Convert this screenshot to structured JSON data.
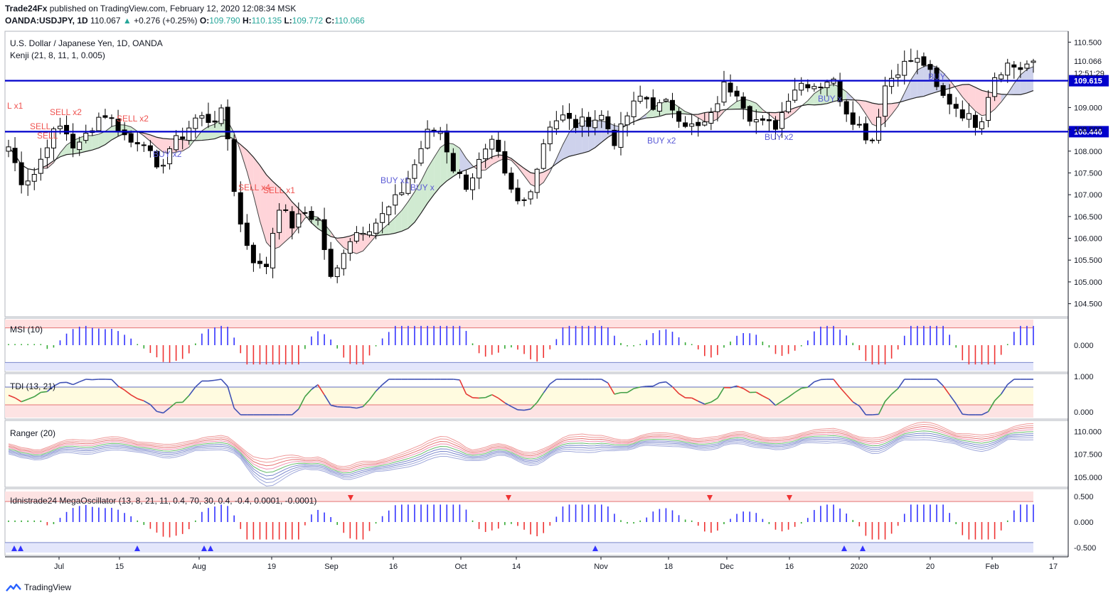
{
  "header": {
    "publisher": "Trade24Fx",
    "published_text": "published on TradingView.com, February 12, 2020 12:08:34 MSK",
    "symbol": "OANDA:USDJPY, 1D",
    "last": "110.067",
    "change": "+0.276 (+0.25%)",
    "o_label": "O:",
    "o": "109.790",
    "h_label": "H:",
    "h": "110.135",
    "l_label": "L:",
    "l": "109.772",
    "c_label": "C:",
    "c": "110.066"
  },
  "main_pane": {
    "title": "U.S. Dollar / Japanese Yen, 1D, OANDA",
    "indicator": "Kenji (21, 8, 11, 1, 0.005)"
  },
  "price_axis": {
    "ticks": [
      "110.500",
      "110.066",
      "109.000",
      "108.500",
      "108.000",
      "107.500",
      "107.000",
      "106.500",
      "106.000",
      "105.500",
      "105.000",
      "104.500"
    ],
    "countdown": "12:51:29",
    "line_labels": [
      "109.615",
      "108.446"
    ]
  },
  "time_axis": {
    "labels": [
      "Jul",
      "15",
      "Aug",
      "19",
      "Sep",
      "16",
      "Oct",
      "14",
      "Nov",
      "18",
      "Dec",
      "16",
      "2020",
      "20",
      "Feb",
      "17"
    ]
  },
  "signals": [
    "L x1",
    "SELL x2",
    "SELL",
    "SELL",
    "SELL x2",
    "BUY x2",
    "SELL x4",
    "SELL x1",
    "BUY x1",
    "BUY x",
    "BUY x2",
    "BUY x2",
    "BUY x",
    "BUY"
  ],
  "msi": {
    "title": "MSI (10)",
    "ticks": [
      "0.000"
    ]
  },
  "tdi": {
    "title": "TDI (13, 21)",
    "ticks": [
      "1.000",
      "0.000"
    ]
  },
  "ranger": {
    "title": "Ranger (20)",
    "ticks": [
      "110.000",
      "107.500",
      "105.000"
    ]
  },
  "mega": {
    "title": "Idnistrade24 MegaOscillator (13, 8, 21, 11, 0.4, 70, 30, 0.4, -0.4, 0.0001, -0.0001)",
    "ticks": [
      "0.500",
      "0.000",
      "-0.500"
    ]
  },
  "footer": {
    "brand": "TradingView"
  },
  "colors": {
    "up": "#26a69a",
    "down": "#000000",
    "hline": "#0000cc",
    "buy": "#5b5bd6",
    "sell": "#ef5350",
    "ribbon_green": "#c8e6c9",
    "ribbon_red": "#ffcdd2",
    "ribbon_blue": "#c5cae9"
  },
  "chart_data": [
    {
      "type": "candlestick",
      "title": "U.S. Dollar / Japanese Yen, 1D, OANDA",
      "x_labels": [
        "Jul",
        "15",
        "Aug",
        "19",
        "Sep",
        "16",
        "Oct",
        "14",
        "Nov",
        "18",
        "Dec",
        "16",
        "2020",
        "20",
        "Feb",
        "17"
      ],
      "ylim": [
        104.2,
        110.75
      ],
      "horizontal_lines": [
        109.615,
        108.446
      ],
      "last_close": 110.066,
      "close_path": [
        108.1,
        107.3,
        107.5,
        108.3,
        108.6,
        108.0,
        108.5,
        108.9,
        108.6,
        108.2,
        108.3,
        107.5,
        108.1,
        108.4,
        108.8,
        108.7,
        108.9,
        106.5,
        105.6,
        105.2,
        106.8,
        106.3,
        106.6,
        106.4,
        104.9,
        105.9,
        106.2,
        106.3,
        106.6,
        107.0,
        107.6,
        108.4,
        108.5,
        107.6,
        107.2,
        107.8,
        108.2,
        107.2,
        106.7,
        107.4,
        108.6,
        108.8,
        108.6,
        108.7,
        108.8,
        108.2,
        108.9,
        109.3,
        109.0,
        109.1,
        108.7,
        108.5,
        108.7,
        109.5,
        109.4,
        108.8,
        108.6,
        108.6,
        109.4,
        109.6,
        109.5,
        109.7,
        109.0,
        108.6,
        108.2,
        109.5,
        109.9,
        110.1,
        110.0,
        109.3,
        109.1,
        108.8,
        108.6,
        109.7,
        110.0,
        109.9,
        110.066
      ]
    },
    {
      "type": "bar",
      "title": "MSI (10)",
      "ylim": [
        -0.28,
        0.28
      ],
      "levels": [
        0.18,
        -0.18
      ]
    },
    {
      "type": "line",
      "title": "TDI (13, 21)",
      "ylim": [
        -0.2,
        1.08
      ],
      "levels": [
        0.7,
        0.2
      ],
      "y_ticks": [
        1.0,
        0.0
      ]
    },
    {
      "type": "line",
      "title": "Ranger (20)",
      "ylim": [
        103.9,
        111.2
      ],
      "y_ticks": [
        110.0,
        107.5,
        105.0
      ]
    },
    {
      "type": "bar",
      "title": "Idnistrade24 MegaOscillator (13, 8, 21, 11, 0.4, 70, 30, 0.4, -0.4, 0.0001, -0.0001)",
      "ylim": [
        -0.65,
        0.65
      ],
      "levels": [
        0.4,
        -0.4
      ],
      "y_ticks": [
        0.5,
        0.0,
        -0.5
      ]
    }
  ]
}
